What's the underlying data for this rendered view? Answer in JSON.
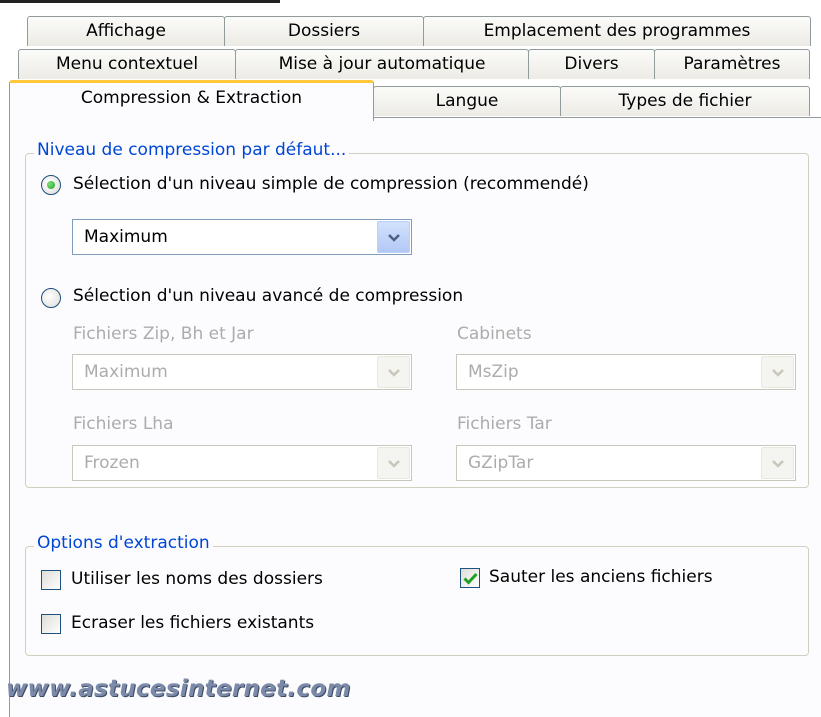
{
  "tabs": {
    "row1": [
      "Affichage",
      "Dossiers",
      "Emplacement des programmes"
    ],
    "row2": [
      "Menu contextuel",
      "Mise à jour automatique",
      "Divers",
      "Paramètres"
    ],
    "row3": [
      "Compression & Extraction",
      "Langue",
      "Types de fichier"
    ],
    "active": "Compression & Extraction"
  },
  "compression": {
    "legend": "Niveau de compression par défaut...",
    "simple_label": "Sélection d'un niveau simple de compression (recommendé)",
    "simple_selected": true,
    "simple_value": "Maximum",
    "advanced_label": "Sélection d'un niveau avancé de compression",
    "advanced_selected": false,
    "zip_label": "Fichiers Zip, Bh et Jar",
    "zip_value": "Maximum",
    "cab_label": "Cabinets",
    "cab_value": "MsZip",
    "lha_label": "Fichiers Lha",
    "lha_value": "Frozen",
    "tar_label": "Fichiers Tar",
    "tar_value": "GZipTar"
  },
  "extraction": {
    "legend": "Options d'extraction",
    "use_folder_names_label": "Utiliser les noms des dossiers",
    "use_folder_names_checked": false,
    "skip_old_label": "Sauter les anciens fichiers",
    "skip_old_checked": true,
    "overwrite_label": "Ecraser les fichiers existants",
    "overwrite_checked": false
  },
  "watermark": "www.astucesinternet.com",
  "colors": {
    "accent_blue": "#0046d5",
    "active_tab_highlight": "#ffc83c",
    "checkmark_green": "#21a121",
    "disabled_text": "#acacac"
  }
}
